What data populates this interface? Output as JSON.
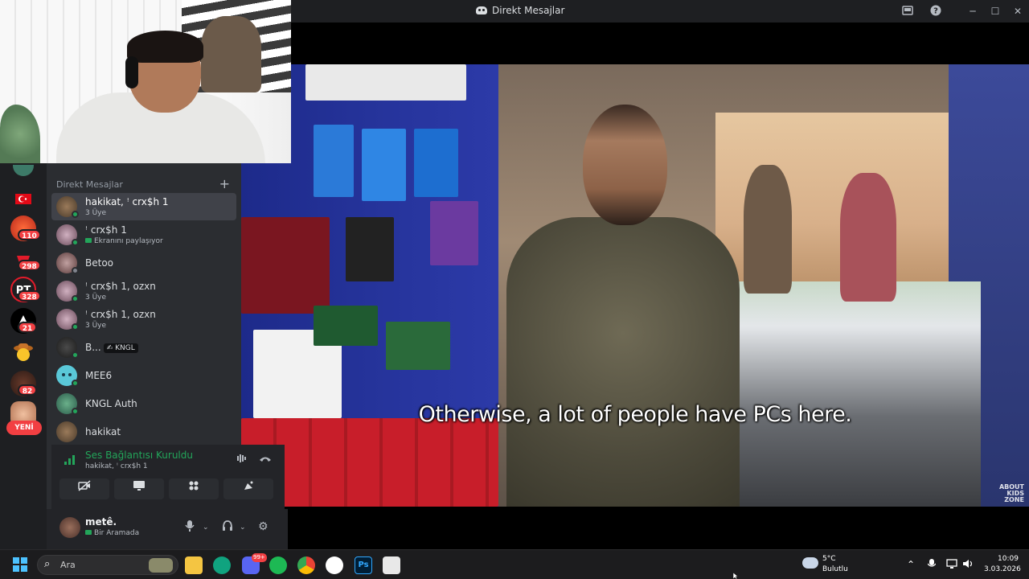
{
  "window": {
    "title": "Direkt Mesajlar",
    "controls": [
      "inbox-icon",
      "help-icon",
      "minimize-icon",
      "maximize-icon",
      "close-icon"
    ]
  },
  "video": {
    "subtitle": "Otherwise, a lot of people have PCs here.",
    "watermark_lines": [
      "ABOUT",
      "KIDS",
      "ZONE"
    ]
  },
  "servers": [
    {
      "icon": "server-turkey-icon"
    },
    {
      "icon": "server-red-icon",
      "badge": "110"
    },
    {
      "icon": "server-red-icon",
      "badge": "298"
    },
    {
      "icon": "server-pt-icon",
      "badge": "328"
    },
    {
      "icon": "server-a-icon",
      "badge": "21"
    },
    {
      "icon": "server-cowboy-icon"
    },
    {
      "icon": "server-orange-icon",
      "badge": "82"
    },
    {
      "icon": "server-avatar-icon"
    }
  ],
  "new_pill": "YENİ",
  "dm": {
    "header": "Direkt Mesajlar",
    "items": [
      {
        "name": "hakikat, ꜝ crx$h 1",
        "sub": "3 Üye"
      },
      {
        "name": "ꜝ crx$h 1",
        "sub": "Ekranını paylaşıyor"
      },
      {
        "name": "Betoo"
      },
      {
        "name": "ꜝ crx$h 1, ozxn",
        "sub": "3 Üye"
      },
      {
        "name": "ꜝ crx$h 1, ozxn",
        "sub": "3 Üye"
      },
      {
        "name": "B...",
        "tag": "✍ KNGL"
      },
      {
        "name": "MEE6"
      },
      {
        "name": "KNGL Auth"
      },
      {
        "name": "hakikat"
      }
    ]
  },
  "voice": {
    "title": "Ses Bağlantısı Kuruldu",
    "sub": "hakikat, ꜝ crx$h 1"
  },
  "user": {
    "name": "metê.",
    "status": "Bir Aramada"
  },
  "taskbar": {
    "search_placeholder": "Ara",
    "weather_temp": "5°C",
    "weather_desc": "Bulutlu",
    "time": "10:09",
    "date": "3.03.2026",
    "discord_badge": "99+"
  },
  "colors": {
    "accent_green": "#23a55a",
    "badge_red": "#f23f42",
    "sidebar": "#2b2d31",
    "rail": "#1e1f22"
  }
}
